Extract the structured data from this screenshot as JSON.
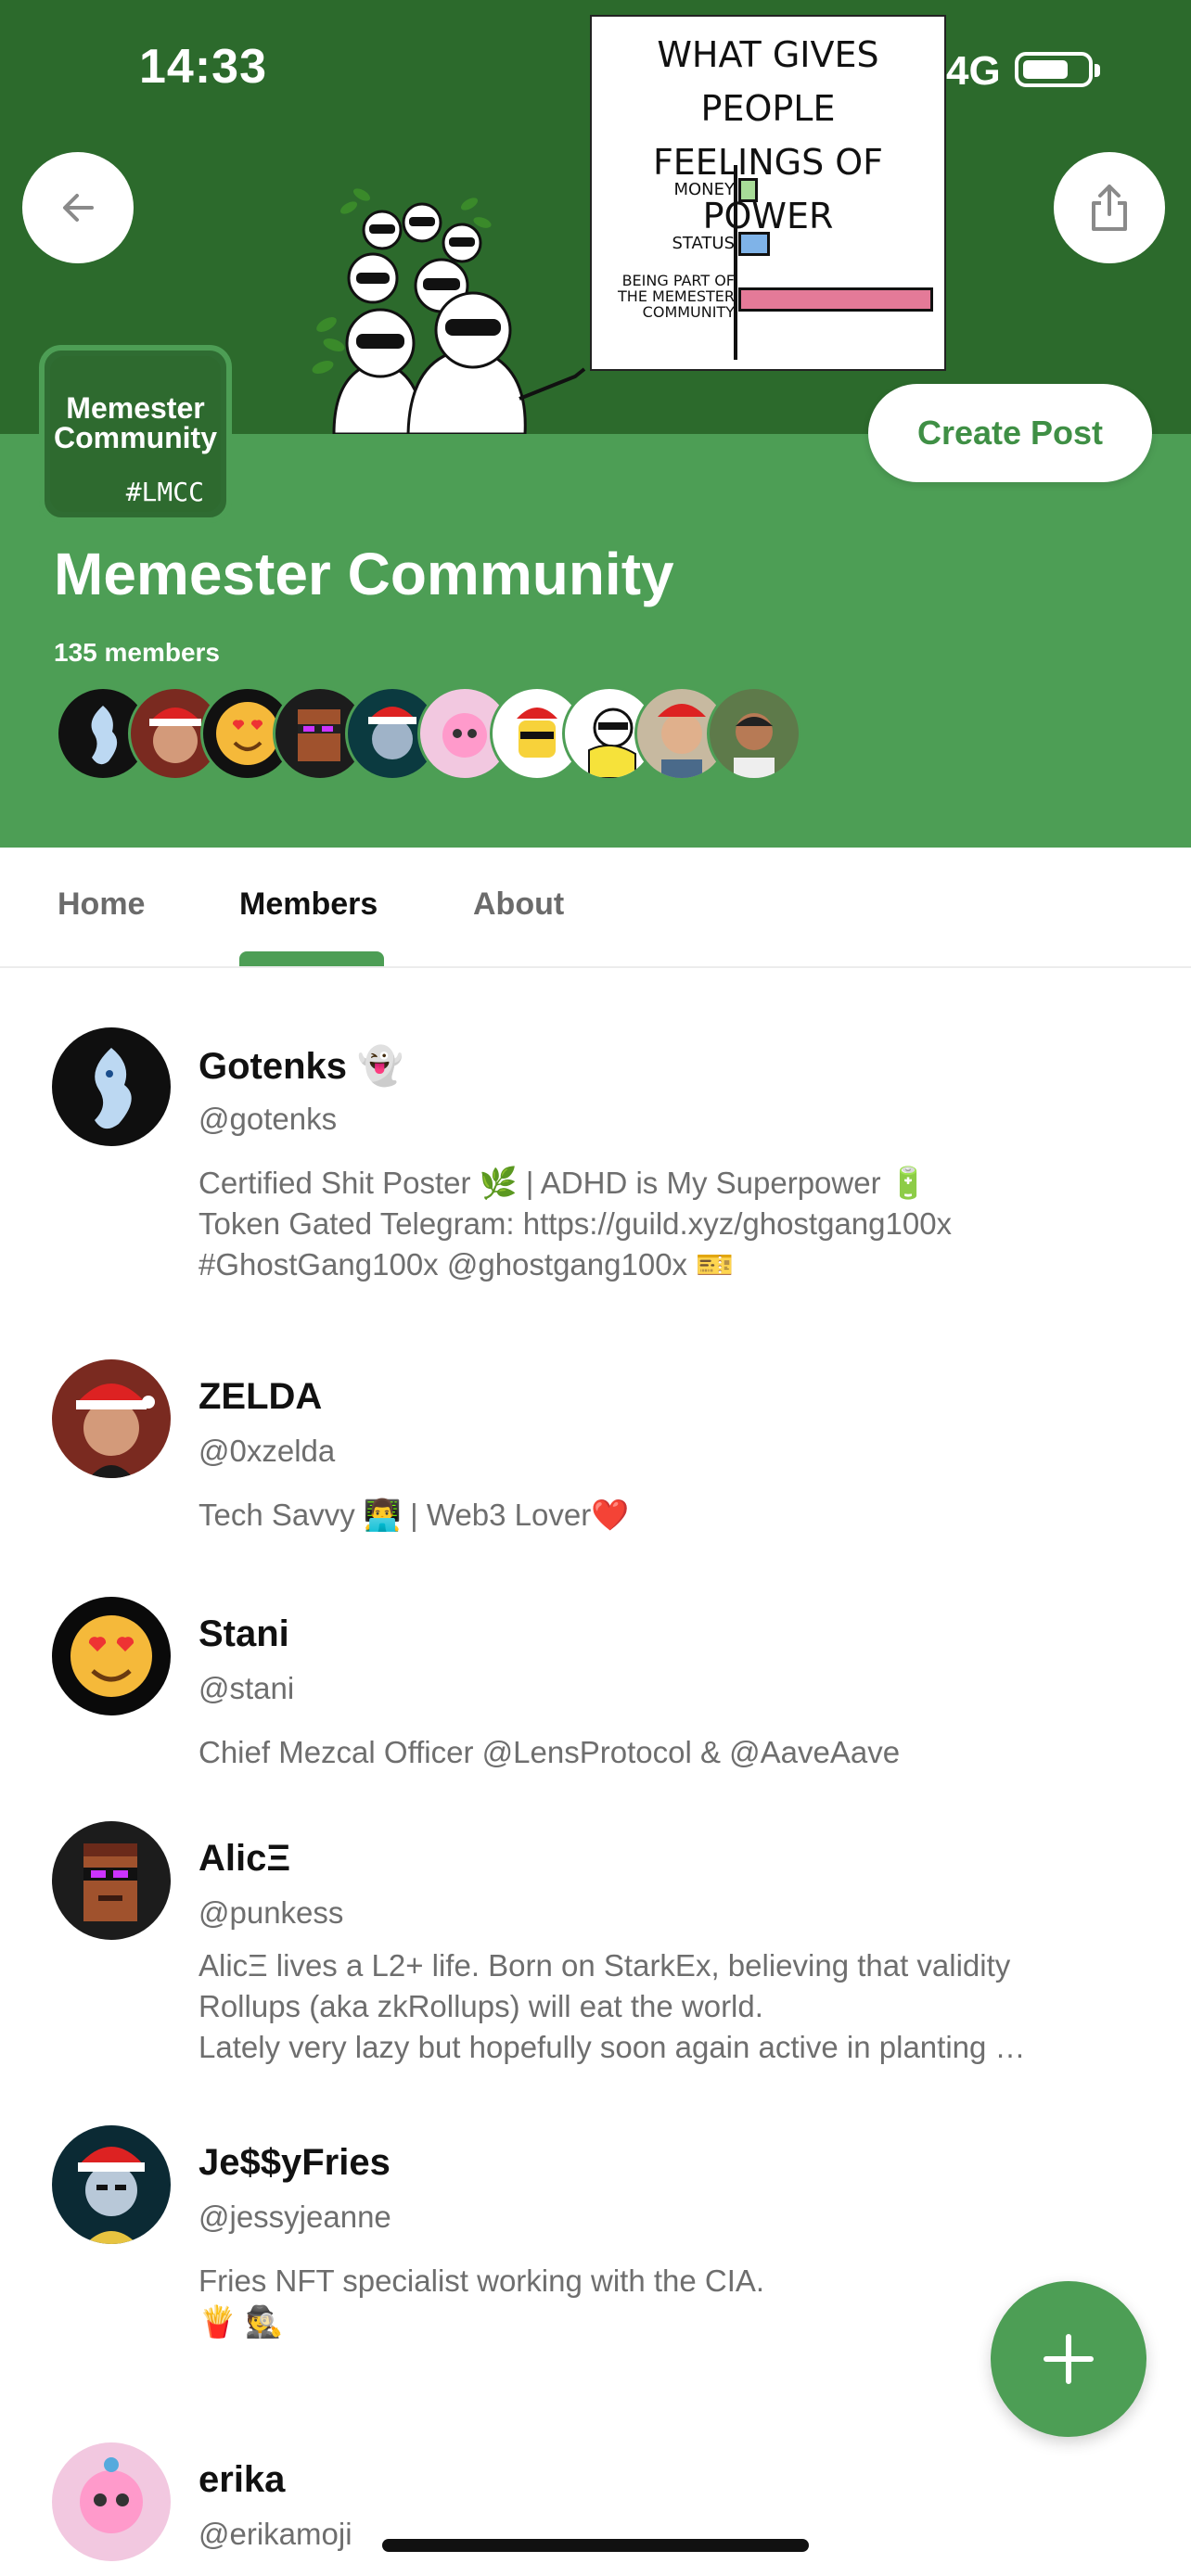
{
  "status_bar": {
    "time": "14:33",
    "network": "4G"
  },
  "banner": {
    "comic": {
      "title_line1": "WHAT GIVES PEOPLE",
      "title_line2": "FEELINGS OF POWER",
      "rows": [
        {
          "label": "MONEY",
          "value": 0.1,
          "color": "#a8dc98"
        },
        {
          "label": "STATUS",
          "value": 0.16,
          "color": "#7fb3e8"
        },
        {
          "label": "BEING PART OF THE MEMESTER COMMUNITY",
          "value": 1.0,
          "color": "#e47a98"
        }
      ]
    }
  },
  "community": {
    "logo_line1": "Memester",
    "logo_line2": "Community",
    "logo_tag": "#LMCC",
    "name": "Memester Community",
    "member_count": "135 members",
    "create_post_label": "Create Post"
  },
  "tabs": [
    {
      "label": "Home",
      "active": false
    },
    {
      "label": "Members",
      "active": true
    },
    {
      "label": "About",
      "active": false
    }
  ],
  "members": [
    {
      "name": "Gotenks 👻",
      "handle": "@gotenks",
      "avatar": "ghost-dragon",
      "bio": [
        "Certified Shit Poster 🌿  | ADHD is My Superpower 🔋",
        "Token Gated Telegram: https://guild.xyz/ghostgang100x",
        "#GhostGang100x @ghostgang100x 🎫"
      ]
    },
    {
      "name": "ZELDA",
      "handle": "@0xzelda",
      "avatar": "santa-man",
      "bio": [
        "Tech Savvy 👨‍💻  | Web3 Lover❤️"
      ]
    },
    {
      "name": "Stani",
      "handle": "@stani",
      "avatar": "heart-eyes",
      "bio": [
        "Chief Mezcal Officer @LensProtocol & @AaveAave"
      ]
    },
    {
      "name": "AlicΞ",
      "handle": "@punkess",
      "avatar": "pixel-punk",
      "bio": [
        "AlicΞ lives a L2+ life. Born on StarkEx, believing that validity",
        "Rollups (aka zkRollups) will eat the world.",
        "Lately very lazy but hopefully soon again active in planting …"
      ]
    },
    {
      "name": "Je$$yFries",
      "handle": "@jessyjeanne",
      "avatar": "santa-girl",
      "bio": [
        "Fries NFT specialist working with the CIA.",
        "🍟 🕵️"
      ]
    },
    {
      "name": "erika",
      "handle": "@erikamoji",
      "avatar": "pink-anime",
      "bio": []
    }
  ],
  "colors": {
    "banner": "#2c6a2c",
    "accent": "#4d9e55",
    "accent_text": "#3f8f45"
  },
  "icons": {
    "back": "arrow-left-icon",
    "share": "share-icon",
    "fab": "plus-icon"
  }
}
